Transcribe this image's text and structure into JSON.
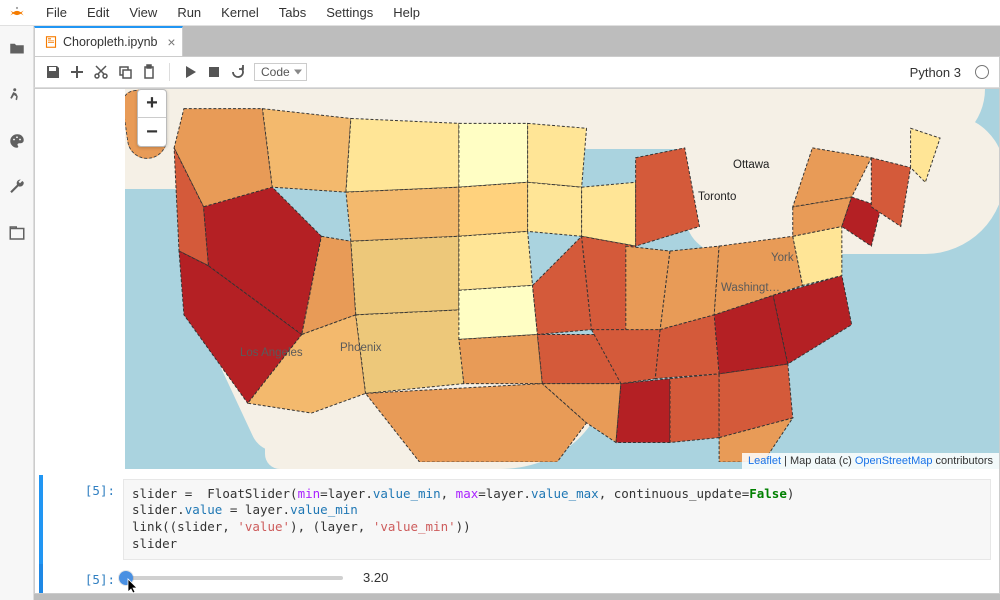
{
  "menubar": {
    "items": [
      "File",
      "Edit",
      "View",
      "Run",
      "Kernel",
      "Tabs",
      "Settings",
      "Help"
    ]
  },
  "tab": {
    "title": "Choropleth.ipynb"
  },
  "toolbar": {
    "celltype": "Code",
    "kernel": "Python 3"
  },
  "map": {
    "zoom_in": "+",
    "zoom_out": "−",
    "cities": {
      "la": "Los Angeles",
      "phoenix": "Phoenix",
      "toronto": "Toronto",
      "ottawa": "Ottawa",
      "ny": "York",
      "dc": "Washingt…"
    },
    "attr_leaflet": "Leaflet",
    "attr_mid": " | Map data (c) ",
    "attr_osm": "OpenStreetMap",
    "attr_tail": " contributors"
  },
  "code": {
    "prompt": "[5]:",
    "line1a": "slider ",
    "line1b": " FloatSlider(",
    "line1c": "min",
    "line1d": "layer",
    "line1e": "value_min",
    "line1f": "max",
    "line1g": "value_max",
    "line1h": ", continuous_update",
    "line1i": "False",
    "line2a": "slider",
    "line2b": "value",
    "line2c": " layer",
    "line2d": "value_min",
    "line3a": "link((slider, ",
    "line3b": "'value'",
    "line3c": "), (layer, ",
    "line3d": "'value_min'",
    "line3e": "))",
    "line4": "slider"
  },
  "slider": {
    "prompt": "[5]:",
    "value": "3.20"
  }
}
